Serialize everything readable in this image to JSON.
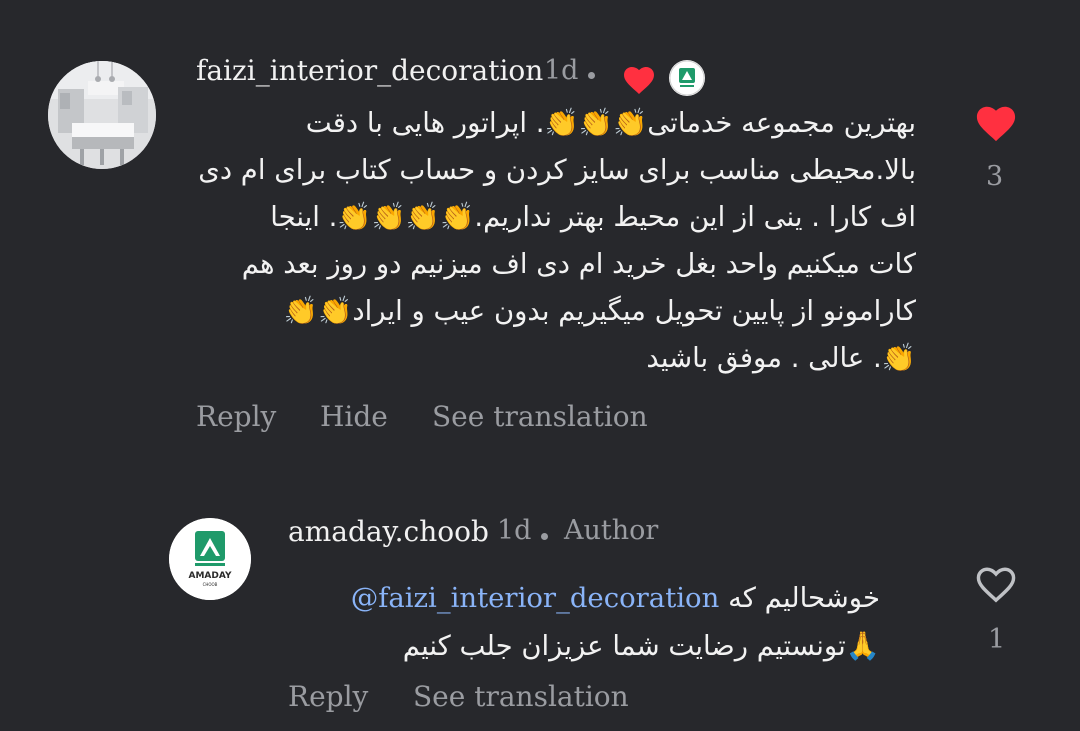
{
  "comments": [
    {
      "username": "faizi_interior_decoration",
      "time": "1d",
      "lines": [
        "بهترین مجموعه خدماتی👏👏👏. اپراتور هایی با دقت",
        "بالا.محیطی مناسب برای سایز کردن و حساب کتاب برای ام دی",
        "اف کارا . ینی از این محیط بهتر نداریم.👏👏👏👏. اینجا",
        "کات میکنیم واحد بغل خرید ام دی اف میزنیم دو روز بعد هم",
        "کارامونو از پایین تحویل میگیریم بدون عیب و ایراد👏👏",
        "👏. عالی . موفق باشید"
      ],
      "like_count": "3",
      "actions": {
        "reply": "Reply",
        "hide": "Hide",
        "translate": "See translation"
      }
    },
    {
      "username": "amaday.choob",
      "time": "1d",
      "author_label": "Author",
      "mention": "@faizi_interior_decoration",
      "line1_text": "خوشحالیم که",
      "line2": "🙏تونستیم رضایت شما عزیزان جلب کنیم",
      "like_count": "1",
      "actions": {
        "reply": "Reply",
        "translate": "See translation"
      },
      "avatar_brand": "AMADAY",
      "avatar_sub": "CHOOB"
    }
  ],
  "icons": {
    "liked_heart": "heart-filled-icon",
    "like_heart": "heart-outline-icon",
    "creator_badge": "badge-icon"
  },
  "colors": {
    "background": "#27282c",
    "like_red": "#ff3040",
    "muted": "#9a9ca1",
    "mention": "#8ab4f8",
    "brand_green": "#1f9a6a"
  }
}
